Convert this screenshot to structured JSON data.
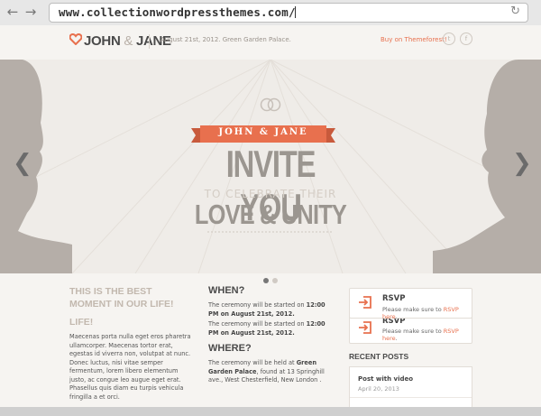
{
  "browser": {
    "url": "www.collectionwordpressthemes.com/"
  },
  "header": {
    "logo_left": "JOHN",
    "logo_amp": "&",
    "logo_right": "JANE",
    "tagline": "August 21st, 2012. Green Garden Palace.",
    "buy_link": "Buy on Themeforest!"
  },
  "slider": {
    "ribbon": "JOHN & JANE",
    "line1": "INVITE YOU",
    "line2": "TO CELEBRATE THEIR",
    "line3": "LOVE & UNITY"
  },
  "left_column": {
    "heading": "THIS IS THE BEST MOMENT IN OUR LIFE!",
    "heading2": "LIFE!",
    "body": "Maecenas porta nulla eget eros pharetra ullamcorper. Maecenas tortor erat, egestas id viverra non, volutpat at nunc. Donec luctus, nisi vitae semper fermentum, lorem libero elementum justo, ac congue leo augue eget erat. Phasellus quis diam eu turpis vehicula fringilla a et orci."
  },
  "middle_column": {
    "when_title": "WHEN?",
    "when_text_a": "The ceremony will be started on",
    "when_text_b": "12:00 PM on August 21st, 2012.",
    "where_title": "WHERE?",
    "where_text_a": "The ceremony will be held at",
    "where_text_b": "Green Garden Palace",
    "where_text_c": ", found at 13 Springhill ave., West Chesterfield, New London ."
  },
  "right_column": {
    "rsvp_title": "RSVP",
    "rsvp_text": "Please make sure to",
    "rsvp_link": "RSVP here",
    "rsvp_end": ".",
    "rsvp_title_2": "RSVP",
    "recent_title": "RECENT POSTS",
    "post_title": "Post with video",
    "post_date": "April 20, 2013"
  },
  "colors": {
    "accent": "#e8704e",
    "silhouette": "#b5aea8",
    "heading_text": "#9b9690"
  }
}
